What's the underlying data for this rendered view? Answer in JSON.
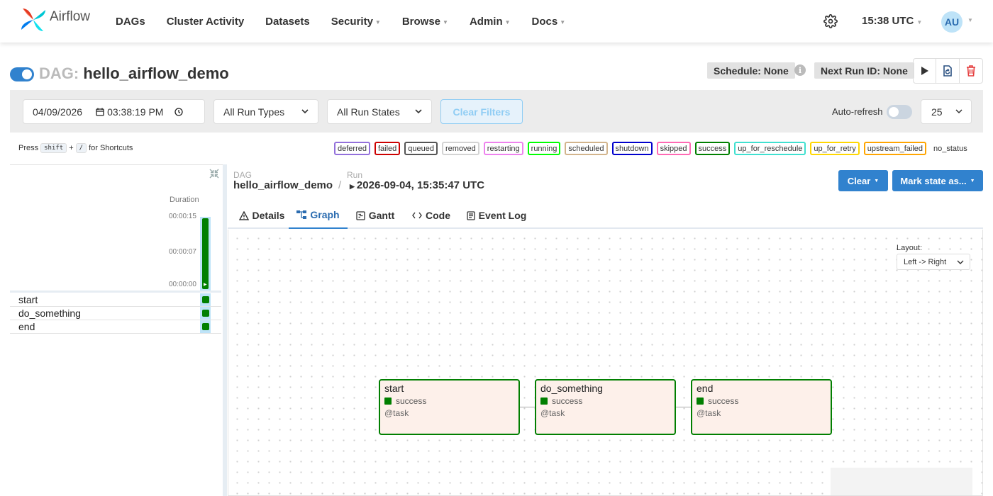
{
  "nav": {
    "logo_text": "Airflow",
    "items": [
      "DAGs",
      "Cluster Activity",
      "Datasets",
      "Security",
      "Browse",
      "Admin",
      "Docs"
    ],
    "time": "15:38 UTC",
    "avatar": "AU"
  },
  "dag": {
    "prefix": "DAG:",
    "name": "hello_airflow_demo",
    "schedule": "Schedule: None",
    "next_run": "Next Run ID: None"
  },
  "filters": {
    "date": "04/09/2026",
    "time": "03:38:19 PM",
    "run_types": "All Run Types",
    "run_states": "All Run States",
    "clear_filters": "Clear Filters",
    "auto_refresh": "Auto-refresh",
    "page_size": "25"
  },
  "shortcuts": {
    "press": "Press",
    "key1": "shift",
    "plus": "+",
    "key2": "/",
    "suffix": "for Shortcuts"
  },
  "legend": [
    {
      "label": "deferred",
      "color": "#9370db"
    },
    {
      "label": "failed",
      "color": "#cc0000"
    },
    {
      "label": "queued",
      "color": "#555555"
    },
    {
      "label": "removed",
      "color": "#d3d3d3"
    },
    {
      "label": "restarting",
      "color": "#ee82ee"
    },
    {
      "label": "running",
      "color": "#00ff00"
    },
    {
      "label": "scheduled",
      "color": "#d2b48c"
    },
    {
      "label": "shutdown",
      "color": "#0000cc"
    },
    {
      "label": "skipped",
      "color": "#ff69b4"
    },
    {
      "label": "success",
      "color": "#008000"
    },
    {
      "label": "up_for_reschedule",
      "color": "#40e0d0"
    },
    {
      "label": "up_for_retry",
      "color": "#ffd700"
    },
    {
      "label": "upstream_failed",
      "color": "#ffa500"
    }
  ],
  "legend_no_status": "no_status",
  "grid": {
    "duration_label": "Duration",
    "ticks": [
      "00:00:15",
      "00:00:07",
      "00:00:00"
    ],
    "tasks": [
      "start",
      "do_something",
      "end"
    ]
  },
  "details": {
    "dag_label": "DAG",
    "dag_name": "hello_airflow_demo",
    "slash": "/",
    "run_label": "Run",
    "run_value": "2026-09-04, 15:35:47 UTC",
    "clear_btn": "Clear",
    "mark_state_btn": "Mark state as..."
  },
  "tabs": [
    "Details",
    "Graph",
    "Gantt",
    "Code",
    "Event Log"
  ],
  "graph": {
    "layout_label": "Layout:",
    "layout_value": "Left -> Right",
    "nodes": [
      {
        "name": "start",
        "state": "success",
        "type": "@task"
      },
      {
        "name": "do_something",
        "state": "success",
        "type": "@task"
      },
      {
        "name": "end",
        "state": "success",
        "type": "@task"
      }
    ]
  },
  "colors": {
    "success": "#017f01",
    "primary": "#3182ce"
  }
}
